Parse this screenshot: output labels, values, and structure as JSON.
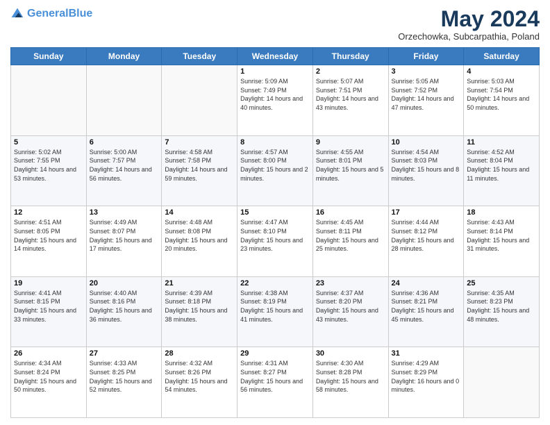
{
  "header": {
    "logo_line1": "General",
    "logo_line2": "Blue",
    "month": "May 2024",
    "location": "Orzechowka, Subcarpathia, Poland"
  },
  "weekdays": [
    "Sunday",
    "Monday",
    "Tuesday",
    "Wednesday",
    "Thursday",
    "Friday",
    "Saturday"
  ],
  "weeks": [
    [
      {
        "day": "",
        "sunrise": "",
        "sunset": "",
        "daylight": ""
      },
      {
        "day": "",
        "sunrise": "",
        "sunset": "",
        "daylight": ""
      },
      {
        "day": "",
        "sunrise": "",
        "sunset": "",
        "daylight": ""
      },
      {
        "day": "1",
        "sunrise": "Sunrise: 5:09 AM",
        "sunset": "Sunset: 7:49 PM",
        "daylight": "Daylight: 14 hours and 40 minutes."
      },
      {
        "day": "2",
        "sunrise": "Sunrise: 5:07 AM",
        "sunset": "Sunset: 7:51 PM",
        "daylight": "Daylight: 14 hours and 43 minutes."
      },
      {
        "day": "3",
        "sunrise": "Sunrise: 5:05 AM",
        "sunset": "Sunset: 7:52 PM",
        "daylight": "Daylight: 14 hours and 47 minutes."
      },
      {
        "day": "4",
        "sunrise": "Sunrise: 5:03 AM",
        "sunset": "Sunset: 7:54 PM",
        "daylight": "Daylight: 14 hours and 50 minutes."
      }
    ],
    [
      {
        "day": "5",
        "sunrise": "Sunrise: 5:02 AM",
        "sunset": "Sunset: 7:55 PM",
        "daylight": "Daylight: 14 hours and 53 minutes."
      },
      {
        "day": "6",
        "sunrise": "Sunrise: 5:00 AM",
        "sunset": "Sunset: 7:57 PM",
        "daylight": "Daylight: 14 hours and 56 minutes."
      },
      {
        "day": "7",
        "sunrise": "Sunrise: 4:58 AM",
        "sunset": "Sunset: 7:58 PM",
        "daylight": "Daylight: 14 hours and 59 minutes."
      },
      {
        "day": "8",
        "sunrise": "Sunrise: 4:57 AM",
        "sunset": "Sunset: 8:00 PM",
        "daylight": "Daylight: 15 hours and 2 minutes."
      },
      {
        "day": "9",
        "sunrise": "Sunrise: 4:55 AM",
        "sunset": "Sunset: 8:01 PM",
        "daylight": "Daylight: 15 hours and 5 minutes."
      },
      {
        "day": "10",
        "sunrise": "Sunrise: 4:54 AM",
        "sunset": "Sunset: 8:03 PM",
        "daylight": "Daylight: 15 hours and 8 minutes."
      },
      {
        "day": "11",
        "sunrise": "Sunrise: 4:52 AM",
        "sunset": "Sunset: 8:04 PM",
        "daylight": "Daylight: 15 hours and 11 minutes."
      }
    ],
    [
      {
        "day": "12",
        "sunrise": "Sunrise: 4:51 AM",
        "sunset": "Sunset: 8:05 PM",
        "daylight": "Daylight: 15 hours and 14 minutes."
      },
      {
        "day": "13",
        "sunrise": "Sunrise: 4:49 AM",
        "sunset": "Sunset: 8:07 PM",
        "daylight": "Daylight: 15 hours and 17 minutes."
      },
      {
        "day": "14",
        "sunrise": "Sunrise: 4:48 AM",
        "sunset": "Sunset: 8:08 PM",
        "daylight": "Daylight: 15 hours and 20 minutes."
      },
      {
        "day": "15",
        "sunrise": "Sunrise: 4:47 AM",
        "sunset": "Sunset: 8:10 PM",
        "daylight": "Daylight: 15 hours and 23 minutes."
      },
      {
        "day": "16",
        "sunrise": "Sunrise: 4:45 AM",
        "sunset": "Sunset: 8:11 PM",
        "daylight": "Daylight: 15 hours and 25 minutes."
      },
      {
        "day": "17",
        "sunrise": "Sunrise: 4:44 AM",
        "sunset": "Sunset: 8:12 PM",
        "daylight": "Daylight: 15 hours and 28 minutes."
      },
      {
        "day": "18",
        "sunrise": "Sunrise: 4:43 AM",
        "sunset": "Sunset: 8:14 PM",
        "daylight": "Daylight: 15 hours and 31 minutes."
      }
    ],
    [
      {
        "day": "19",
        "sunrise": "Sunrise: 4:41 AM",
        "sunset": "Sunset: 8:15 PM",
        "daylight": "Daylight: 15 hours and 33 minutes."
      },
      {
        "day": "20",
        "sunrise": "Sunrise: 4:40 AM",
        "sunset": "Sunset: 8:16 PM",
        "daylight": "Daylight: 15 hours and 36 minutes."
      },
      {
        "day": "21",
        "sunrise": "Sunrise: 4:39 AM",
        "sunset": "Sunset: 8:18 PM",
        "daylight": "Daylight: 15 hours and 38 minutes."
      },
      {
        "day": "22",
        "sunrise": "Sunrise: 4:38 AM",
        "sunset": "Sunset: 8:19 PM",
        "daylight": "Daylight: 15 hours and 41 minutes."
      },
      {
        "day": "23",
        "sunrise": "Sunrise: 4:37 AM",
        "sunset": "Sunset: 8:20 PM",
        "daylight": "Daylight: 15 hours and 43 minutes."
      },
      {
        "day": "24",
        "sunrise": "Sunrise: 4:36 AM",
        "sunset": "Sunset: 8:21 PM",
        "daylight": "Daylight: 15 hours and 45 minutes."
      },
      {
        "day": "25",
        "sunrise": "Sunrise: 4:35 AM",
        "sunset": "Sunset: 8:23 PM",
        "daylight": "Daylight: 15 hours and 48 minutes."
      }
    ],
    [
      {
        "day": "26",
        "sunrise": "Sunrise: 4:34 AM",
        "sunset": "Sunset: 8:24 PM",
        "daylight": "Daylight: 15 hours and 50 minutes."
      },
      {
        "day": "27",
        "sunrise": "Sunrise: 4:33 AM",
        "sunset": "Sunset: 8:25 PM",
        "daylight": "Daylight: 15 hours and 52 minutes."
      },
      {
        "day": "28",
        "sunrise": "Sunrise: 4:32 AM",
        "sunset": "Sunset: 8:26 PM",
        "daylight": "Daylight: 15 hours and 54 minutes."
      },
      {
        "day": "29",
        "sunrise": "Sunrise: 4:31 AM",
        "sunset": "Sunset: 8:27 PM",
        "daylight": "Daylight: 15 hours and 56 minutes."
      },
      {
        "day": "30",
        "sunrise": "Sunrise: 4:30 AM",
        "sunset": "Sunset: 8:28 PM",
        "daylight": "Daylight: 15 hours and 58 minutes."
      },
      {
        "day": "31",
        "sunrise": "Sunrise: 4:29 AM",
        "sunset": "Sunset: 8:29 PM",
        "daylight": "Daylight: 16 hours and 0 minutes."
      },
      {
        "day": "",
        "sunrise": "",
        "sunset": "",
        "daylight": ""
      }
    ]
  ]
}
